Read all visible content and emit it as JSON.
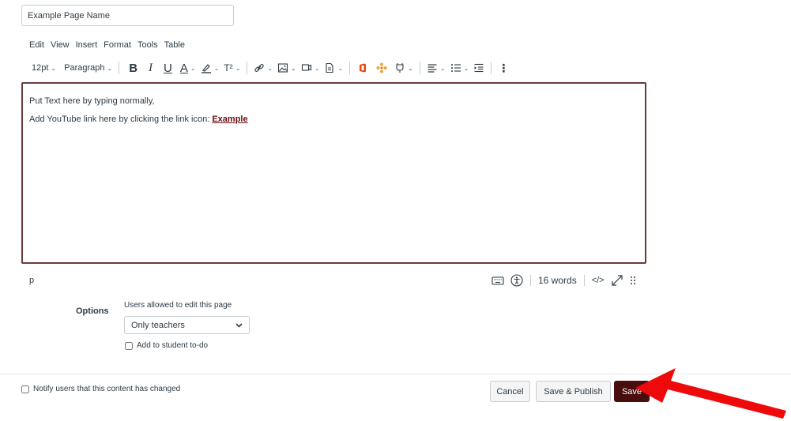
{
  "page": {
    "title_value": "Example Page Name"
  },
  "menubar": [
    "Edit",
    "View",
    "Insert",
    "Format",
    "Tools",
    "Table"
  ],
  "toolbar": {
    "font_size": "12pt",
    "block_format": "Paragraph",
    "bold": "B",
    "italic": "I",
    "underline": "U",
    "text_color": "A",
    "superscript": "T²",
    "more": "⋮"
  },
  "editor": {
    "line1": "Put Text here by typing normally,",
    "line2_prefix": "Add YouTube link here by clicking the link icon: ",
    "link_text": "Example"
  },
  "statusbar": {
    "element_path": "p",
    "word_count": "16 words",
    "html_toggle": "</>"
  },
  "options": {
    "label": "Options",
    "edit_permission_label": "Users allowed to edit this page",
    "edit_permission_value": "Only teachers",
    "todo_label": "Add to student to-do"
  },
  "footer": {
    "notify_label": "Notify users that this content has changed",
    "cancel": "Cancel",
    "save_publish": "Save & Publish",
    "save": "Save"
  },
  "colors": {
    "save_button": "#4a0d0d",
    "editor_border": "#6b3a3a",
    "arrow": "#ee0a0a"
  }
}
